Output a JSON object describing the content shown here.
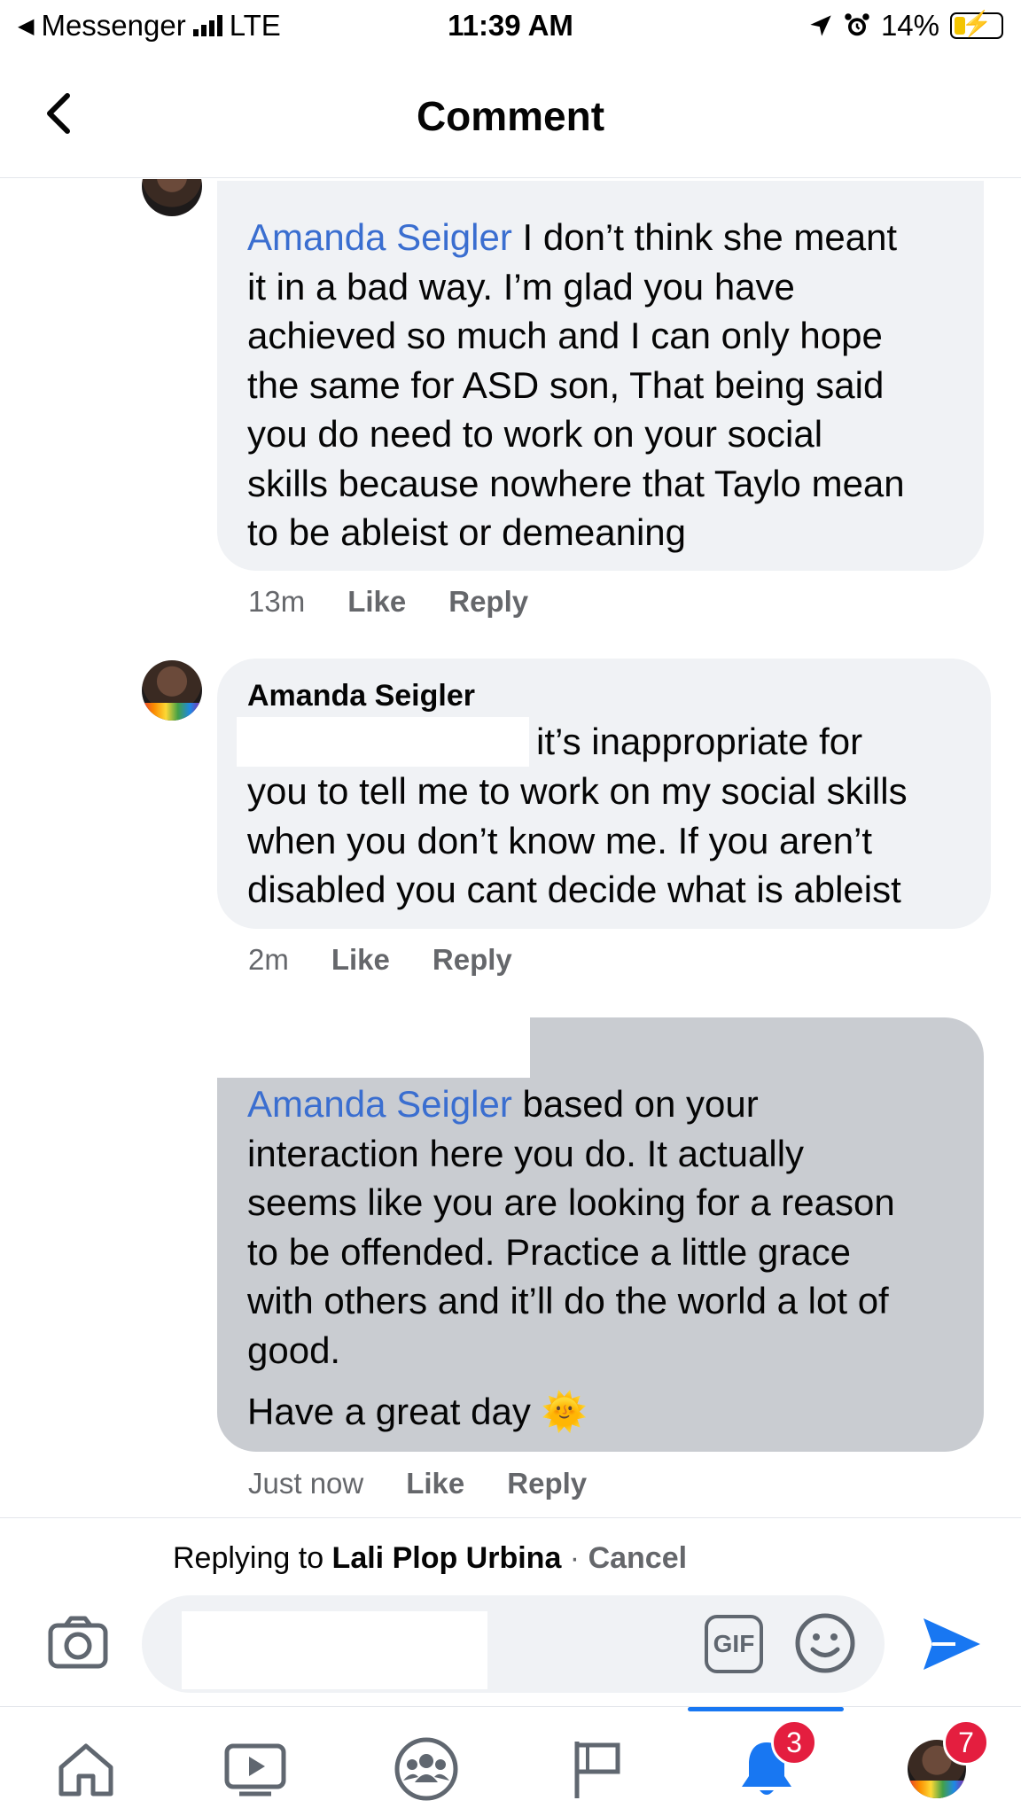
{
  "status_bar": {
    "back_app": "Messenger",
    "network": "LTE",
    "time": "11:39 AM",
    "battery": "14%"
  },
  "header": {
    "title": "Comment"
  },
  "comments": [
    {
      "mention": "Amanda Seigler",
      "text_lines": [
        " I don’t think she meant",
        "it in a bad way. I’m glad you have",
        "achieved so much and I can only hope",
        "the same for ASD son, That being said",
        "you do need to work on your social",
        "skills because nowhere that Taylo mean",
        "to be ableist or demeaning"
      ],
      "time": "13m",
      "like": "Like",
      "reply": "Reply"
    },
    {
      "author": "Amanda Seigler",
      "text_lines": [
        "it’s inappropriate for",
        "you to tell me to work on my social skills",
        "when you don’t know me. If you aren’t",
        "disabled you cant decide what is ableist"
      ],
      "time": "2m",
      "like": "Like",
      "reply": "Reply"
    },
    {
      "mention": "Amanda Seigler",
      "text_lines": [
        " based on your",
        "interaction here you do. It actually",
        "seems like you are looking for a reason",
        "to be offended. Practice a little grace",
        "with others and it’ll do the world a lot of",
        "good."
      ],
      "closing": "Have a great day",
      "emoji": "🌞",
      "time": "Just now",
      "like": "Like",
      "reply": "Reply"
    }
  ],
  "reply_bar": {
    "prefix": "Replying to ",
    "name": "Lali Plop Urbina",
    "separator": " · ",
    "cancel": "Cancel"
  },
  "composer": {
    "gif_label": "GIF"
  },
  "nav": {
    "notifications_badge": "3",
    "menu_badge": "7"
  },
  "colors": {
    "accent": "#1877f2",
    "mention": "#3a6ed0",
    "badge": "#e41e3f"
  }
}
